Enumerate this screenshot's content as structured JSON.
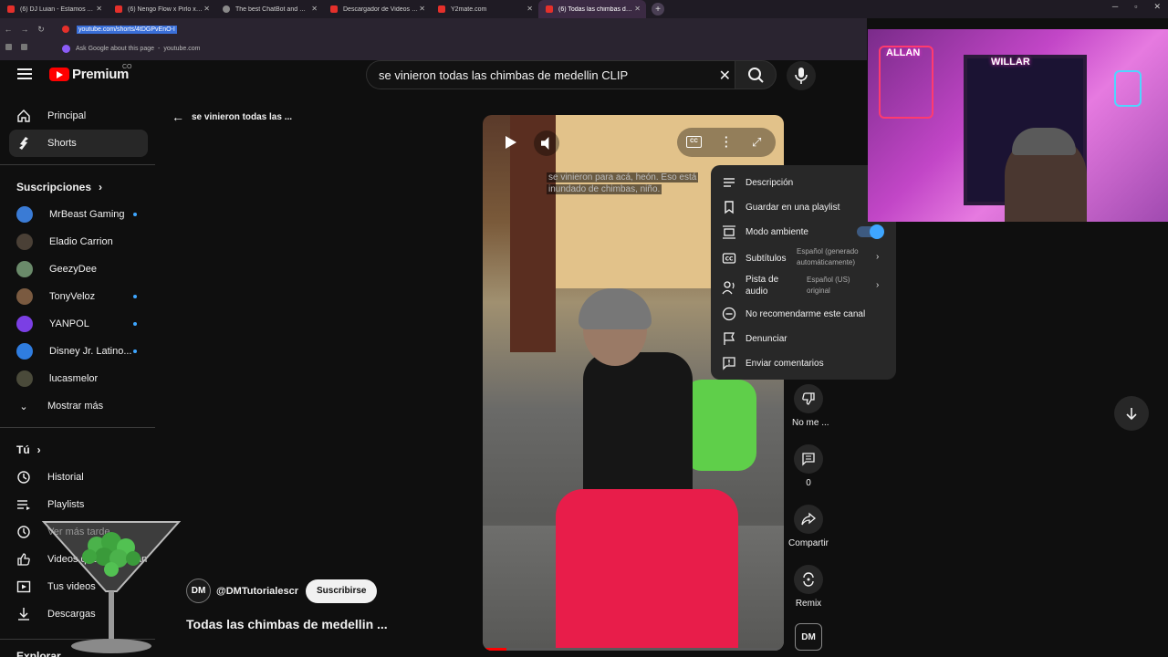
{
  "browser": {
    "tabs": [
      {
        "title": "(6) DJ Luian - Estamos Aqui ft..",
        "active": false
      },
      {
        "title": "(6) Ñengo Flow x Pirlo x Estelu..",
        "active": false
      },
      {
        "title": "The best ChatBot and Widgets",
        "active": false
      },
      {
        "title": "Descargador de Videos de You..",
        "active": false
      },
      {
        "title": "Y2mate.com",
        "active": false
      },
      {
        "title": "(6) Todas las chimbas de medell..",
        "active": true
      }
    ],
    "url": "youtube.com/shorts/4tDGPvEnO-I",
    "suggestion": "Ask Google about this page",
    "suggestion_domain": "youtube.com"
  },
  "header": {
    "logo": "Premium",
    "logo_region": "CO",
    "search_query": "se vinieron todas las chimbas de medellin CLIP"
  },
  "sidebar": {
    "main": [
      {
        "label": "Principal",
        "icon": "home-icon"
      },
      {
        "label": "Shorts",
        "icon": "shorts-icon",
        "active": true
      }
    ],
    "subscriptions_title": "Suscripciones",
    "subscriptions": [
      {
        "label": "MrBeast Gaming",
        "color": "#3a7bd5",
        "new": true
      },
      {
        "label": "Eladio Carrion",
        "color": "#4a4036",
        "new": false
      },
      {
        "label": "GeezyDee",
        "color": "#6a8a6a",
        "new": false
      },
      {
        "label": "TonyVeloz",
        "color": "#7a5a40",
        "new": true
      },
      {
        "label": "YANPOL",
        "color": "#7b3fe4",
        "new": true
      },
      {
        "label": "Disney Jr. Latino...",
        "color": "#2f7de0",
        "new": true
      },
      {
        "label": "lucasmelor",
        "color": "#4a4a3a",
        "new": false
      }
    ],
    "show_more": "Mostrar más",
    "you_title": "Tú",
    "you_items": [
      {
        "label": "Historial",
        "icon": "history-icon"
      },
      {
        "label": "Playlists",
        "icon": "playlists-icon"
      },
      {
        "label": "Ver más tarde",
        "icon": "watch-later-icon"
      },
      {
        "label": "Videos que me gustan",
        "icon": "like-icon"
      },
      {
        "label": "Tus videos",
        "icon": "your-videos-icon"
      },
      {
        "label": "Descargas",
        "icon": "download-icon"
      }
    ],
    "explore_title": "Explorar"
  },
  "short": {
    "back_title": "se vinieron todas las ...",
    "caption_line1": "se vinieron para acá, heón. Eso está",
    "caption_line2": "inundado de chimbas, niño.",
    "cc_label": "CC",
    "progress": 0.08,
    "channel_avatar": "DM",
    "channel": "@DMTutorialescr",
    "subscribe": "Suscribirse",
    "title": "Todas las chimbas de medellin ..."
  },
  "actions": {
    "dislike": "No me ...",
    "comments": "0",
    "share": "Compartir",
    "remix": "Remix",
    "channel_thumb": "DM"
  },
  "menu": {
    "items": [
      {
        "label": "Descripción",
        "icon": "description-icon"
      },
      {
        "label": "Guardar en una playlist",
        "icon": "bookmark-icon"
      },
      {
        "label": "Modo ambiente",
        "icon": "ambient-icon",
        "toggle_on": true
      },
      {
        "label": "Subtítulos",
        "icon": "subtitles-icon",
        "sub": "Español (generado automáticamente)"
      },
      {
        "label": "Pista de audio",
        "icon": "audio-track-icon",
        "sub": "Español (US) original"
      },
      {
        "label": "No recomendarme este canal",
        "icon": "block-icon"
      },
      {
        "label": "Denunciar",
        "icon": "flag-icon"
      },
      {
        "label": "Enviar comentarios",
        "icon": "feedback-icon"
      }
    ]
  },
  "webcam": {
    "sign1": "ALLAN",
    "sign2": "WILLAR"
  },
  "colors": {
    "accent": "#3ea6ff",
    "brand": "#ff0000",
    "skirt": "#e81d4a"
  }
}
